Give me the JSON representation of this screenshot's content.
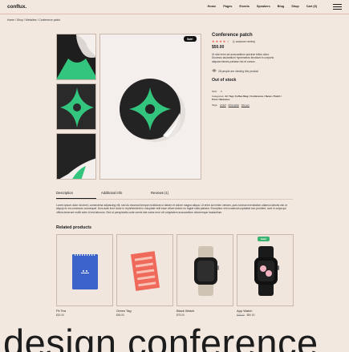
{
  "brand": {
    "logo": "conflux."
  },
  "nav": {
    "items": [
      "Home",
      "Pages",
      "Events",
      "Speakers",
      "Blog",
      "Shop",
      "Cart (0)"
    ]
  },
  "breadcrumb": "Home / Shop / Websites / Conference patch",
  "product": {
    "sale_badge": "Sale!",
    "title": "Conference patch",
    "rating_text": "(1 customer review)",
    "price": "$50.00",
    "description": "Ut wisi enim ad accusantium pulvinar tellus dolor. Ducimus laudantium hymenaeos tincidunt in corporis aliquam fames pariatur nisi et cursus",
    "viewing": "28 people are viewing this product",
    "stock": "Out of stock",
    "sku_label": "SKU:",
    "sku_value": "3",
    "categories_label": "Categories:",
    "categories_value": "Art Tag / Coffee Mug / Conference / News / Patch / Print / Websites",
    "tags_label": "Tags:",
    "tags": [
      "Artfull",
      "Minimalist",
      "Women"
    ]
  },
  "tabs": [
    "Description",
    "Additional info",
    "Reviews (1)"
  ],
  "tab_content": "Lorem ipsum dolor sit amet, consectetur adipiscing elit, sed do eiusmod tempor incididunt ut labore et dolore magna aliqua. Ut enim ad minim veniam, quis nostrud exercitation ullamco laboris nisi ut aliquip ex ea commodo consequat. Duis aute irure dolor in reprehenderit in voluptate velit esse cillum dolore eu fugiat nulla pariatur. Excepteur sint occaecat cupidatat non proident, sunt in culpa qui officia deserunt mollit anim id est laborum. Sed ut perspiciatis unde omnis iste natus error sit voluptatem accusantium doloremque laudantium.",
  "related": {
    "title": "Related products",
    "items": [
      {
        "name": "Fit Tea",
        "price": "$20.00",
        "old_price": ""
      },
      {
        "name": "Green Tag",
        "price": "$45.00",
        "old_price": ""
      },
      {
        "name": "Black Watch",
        "price": "$75.00",
        "old_price": ""
      },
      {
        "name": "App Watch",
        "price": "$50.00",
        "old_price": "$75.00",
        "badge": "Sale!"
      }
    ]
  },
  "footer_banner": "design conference",
  "colors": {
    "background": "#f2e8e0",
    "accent_star": "#e0533b",
    "patch_green": "#33c47e",
    "notebook_blue": "#3b63c9",
    "book_red": "#ef6a5b"
  }
}
